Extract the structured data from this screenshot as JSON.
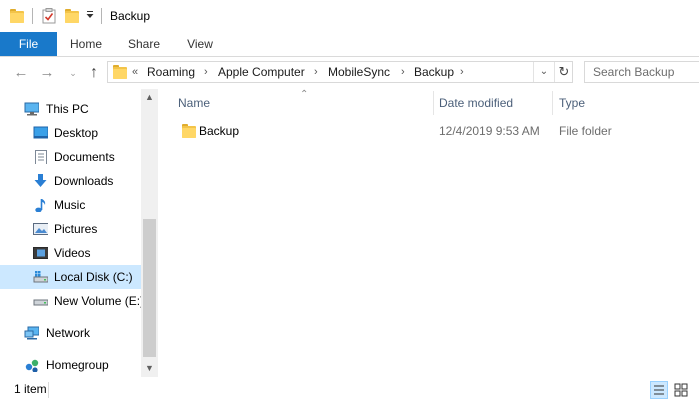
{
  "window": {
    "title": "Backup"
  },
  "ribbon": {
    "tabs": [
      {
        "label": "File"
      },
      {
        "label": "Home"
      },
      {
        "label": "Share"
      },
      {
        "label": "View"
      }
    ]
  },
  "address": {
    "overflow": "«",
    "segments": [
      "Roaming",
      "Apple Computer",
      "MobileSync",
      "Backup"
    ]
  },
  "search": {
    "placeholder": "Search Backup"
  },
  "nav": {
    "items": [
      {
        "label": "This PC",
        "icon": "computer-icon"
      },
      {
        "label": "Desktop",
        "icon": "desktop-icon"
      },
      {
        "label": "Documents",
        "icon": "documents-icon"
      },
      {
        "label": "Downloads",
        "icon": "downloads-icon"
      },
      {
        "label": "Music",
        "icon": "music-icon"
      },
      {
        "label": "Pictures",
        "icon": "pictures-icon"
      },
      {
        "label": "Videos",
        "icon": "videos-icon"
      },
      {
        "label": "Local Disk (C:)",
        "icon": "drive-icon",
        "selected": true
      },
      {
        "label": "New Volume (E:)",
        "icon": "drive-icon"
      },
      {
        "label": "Network",
        "icon": "network-icon"
      },
      {
        "label": "Homegroup",
        "icon": "homegroup-icon"
      }
    ]
  },
  "columns": {
    "name": "Name",
    "date": "Date modified",
    "type": "Type"
  },
  "files": [
    {
      "name": "Backup",
      "date": "12/4/2019 9:53 AM",
      "type": "File folder",
      "icon": "folder-icon"
    }
  ],
  "status": {
    "count": "1 item"
  },
  "colors": {
    "accent": "#1979ca",
    "selected": "#cce8ff",
    "folder": "#ffd766"
  }
}
